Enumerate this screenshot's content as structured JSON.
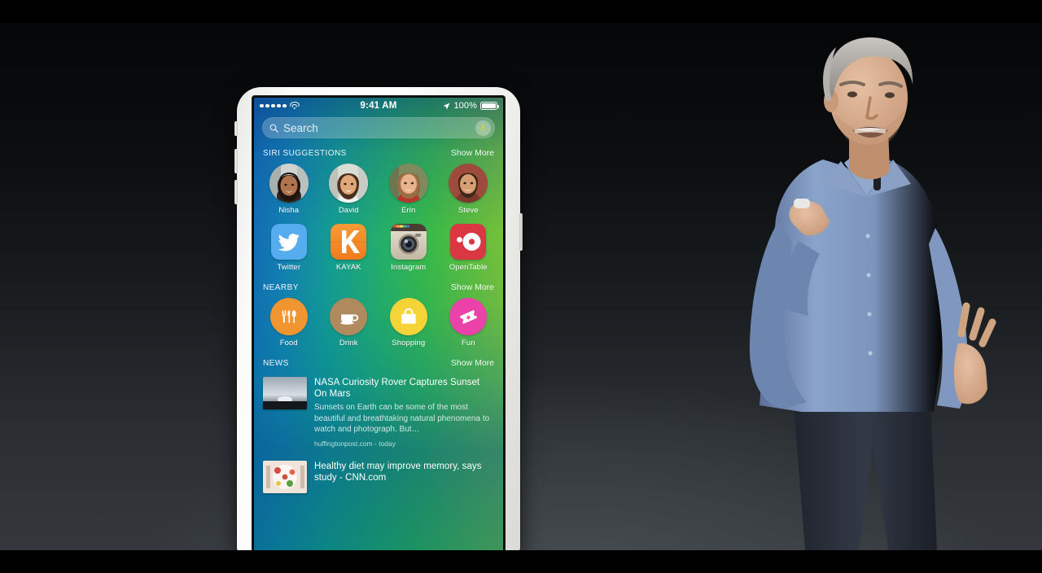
{
  "scene": {
    "description": "Keynote stage: presenter beside an iPhone showing the iOS Spotlight / Siri Suggestions search screen",
    "backdrop_color": "#101315",
    "letterbox_color": "#000000"
  },
  "phone": {
    "frame_color": "#f4f4f2",
    "buttons": [
      "silent-switch",
      "volume-up",
      "volume-down",
      "power"
    ]
  },
  "status_bar": {
    "signal_dots": 5,
    "wifi": "wifi-icon",
    "time": "9:41 AM",
    "location": "location-arrow-icon",
    "battery_percent": "100%",
    "battery": "battery-full-icon"
  },
  "search": {
    "placeholder": "Search",
    "icon": "search-icon",
    "mic": "microphone-icon"
  },
  "sections": {
    "siri": {
      "title": "SIRI SUGGESTIONS",
      "show_more": "Show More",
      "contacts": [
        {
          "name": "Nisha",
          "skin": "#b0744e",
          "hair": "#1f1410",
          "bg": "#cfd3d0"
        },
        {
          "name": "David",
          "skin": "#e0a878",
          "hair": "#4a2f1d",
          "bg": "#dadcd6"
        },
        {
          "name": "Erin",
          "skin": "#e8b28c",
          "hair": "#9a6f44",
          "bg": "#7f8a5e"
        },
        {
          "name": "Steve",
          "skin": "#d79e72",
          "hair": "#3a2418",
          "bg": "#9e4a3c"
        }
      ],
      "apps": [
        {
          "name": "Twitter",
          "bg": "#55acee",
          "glyph": "twitter-bird"
        },
        {
          "name": "KAYAK",
          "bg": "#f4892b",
          "glyph": "letter-k"
        },
        {
          "name": "Instagram",
          "bg": "#d6cbb8",
          "glyph": "camera-lens"
        },
        {
          "name": "OpenTable",
          "bg": "#da3743",
          "glyph": "opentable-circle"
        }
      ]
    },
    "nearby": {
      "title": "NEARBY",
      "show_more": "Show More",
      "items": [
        {
          "name": "Food",
          "bg": "#f0952f",
          "glyph": "utensils-icon"
        },
        {
          "name": "Drink",
          "bg": "#b08a5f",
          "glyph": "coffee-cup-icon"
        },
        {
          "name": "Shopping",
          "bg": "#f5d437",
          "glyph": "shopping-bag-icon"
        },
        {
          "name": "Fun",
          "bg": "#ea42a8",
          "glyph": "ticket-icon"
        }
      ]
    },
    "news": {
      "title": "NEWS",
      "show_more": "Show More",
      "articles": [
        {
          "title": "NASA Curiosity Rover Captures Sunset On Mars",
          "description": "Sunsets on Earth can be some of the most beautiful and breathtaking natural phenomena to watch and photograph. But…",
          "source": "huffingtonpost.com - today",
          "thumb": "mars-sunset-thumbnail"
        },
        {
          "title": "Healthy diet may improve memory, says study - CNN.com",
          "description": "",
          "source": "",
          "thumb": "food-plate-thumbnail"
        }
      ]
    }
  },
  "presenter": {
    "description": "Man with gray hair in light blue button-down shirt and dark jeans, gesturing on stage",
    "shirt_color": "#7d99c4",
    "hair_color": "#a9a7a4"
  }
}
